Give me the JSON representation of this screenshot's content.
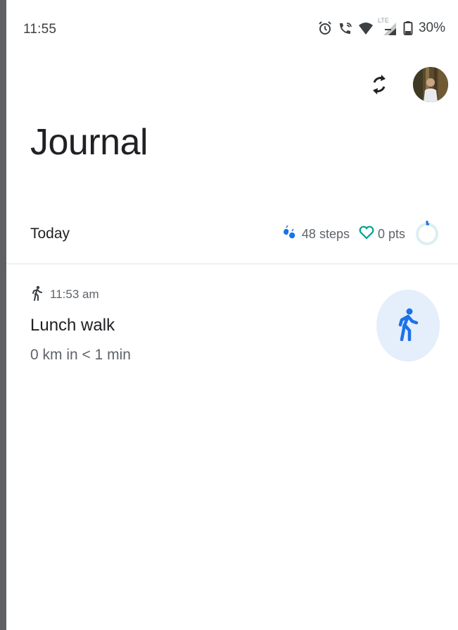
{
  "status_bar": {
    "time": "11:55",
    "network_label": "LTE",
    "battery": "30%",
    "icons": [
      "alarm-icon",
      "wifi-calling-icon",
      "wifi-icon",
      "signal-icon",
      "battery-icon"
    ]
  },
  "header": {
    "sync_icon": "sync-icon",
    "avatar": "profile-avatar"
  },
  "page": {
    "title": "Journal"
  },
  "today": {
    "label": "Today",
    "steps": "48 steps",
    "points": "0 pts",
    "goal_progress": 0.02
  },
  "activities": [
    {
      "time": "11:53 am",
      "title": "Lunch walk",
      "summary": "0 km in < 1 min",
      "type_icon": "walking-icon"
    }
  ],
  "colors": {
    "accent_blue": "#1a73e8",
    "points_teal": "#00a38c",
    "badge_bg": "#e5eefb",
    "divider": "#e3e3e3"
  }
}
